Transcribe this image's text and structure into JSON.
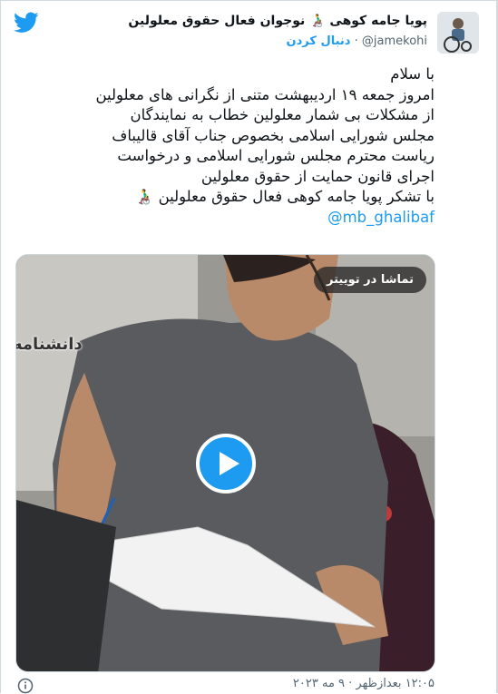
{
  "author": {
    "display_name": "پویا جامه کوهی 👨‍🦽 نوجوان فعال حقوق معلولین",
    "handle": "@jamekohi",
    "separator": "·",
    "follow_label": "دنبال کردن"
  },
  "tweet": {
    "lines": [
      "با سلام",
      "امروز جمعه ۱۹ اردیبهشت متنی از نگرانی های معلولین",
      "از مشکلات بی شمار معلولین خطاب به نمایندگان",
      "مجلس شورایی اسلامی بخصوص جناب آقای قالیباف",
      "ریاست محترم مجلس شورایی اسلامی و درخواست",
      "اجرای قانون حمایت از حقوق معلولین",
      "با تشکر پویا جامه کوهی فعال حقوق معلولین 👨‍🦽"
    ],
    "mention": "@mb_ghalibaf"
  },
  "media": {
    "watch_label": "تماشا در توییتر",
    "watermark": "دانشنامه",
    "play_icon": "play-icon"
  },
  "footer": {
    "timestamp": "۱۲:۰۵ بعدازظهر · ۹ مه ۲۰۲۳"
  },
  "colors": {
    "accent": "#1d9bf0",
    "text": "#0f1419",
    "muted": "#536471"
  }
}
